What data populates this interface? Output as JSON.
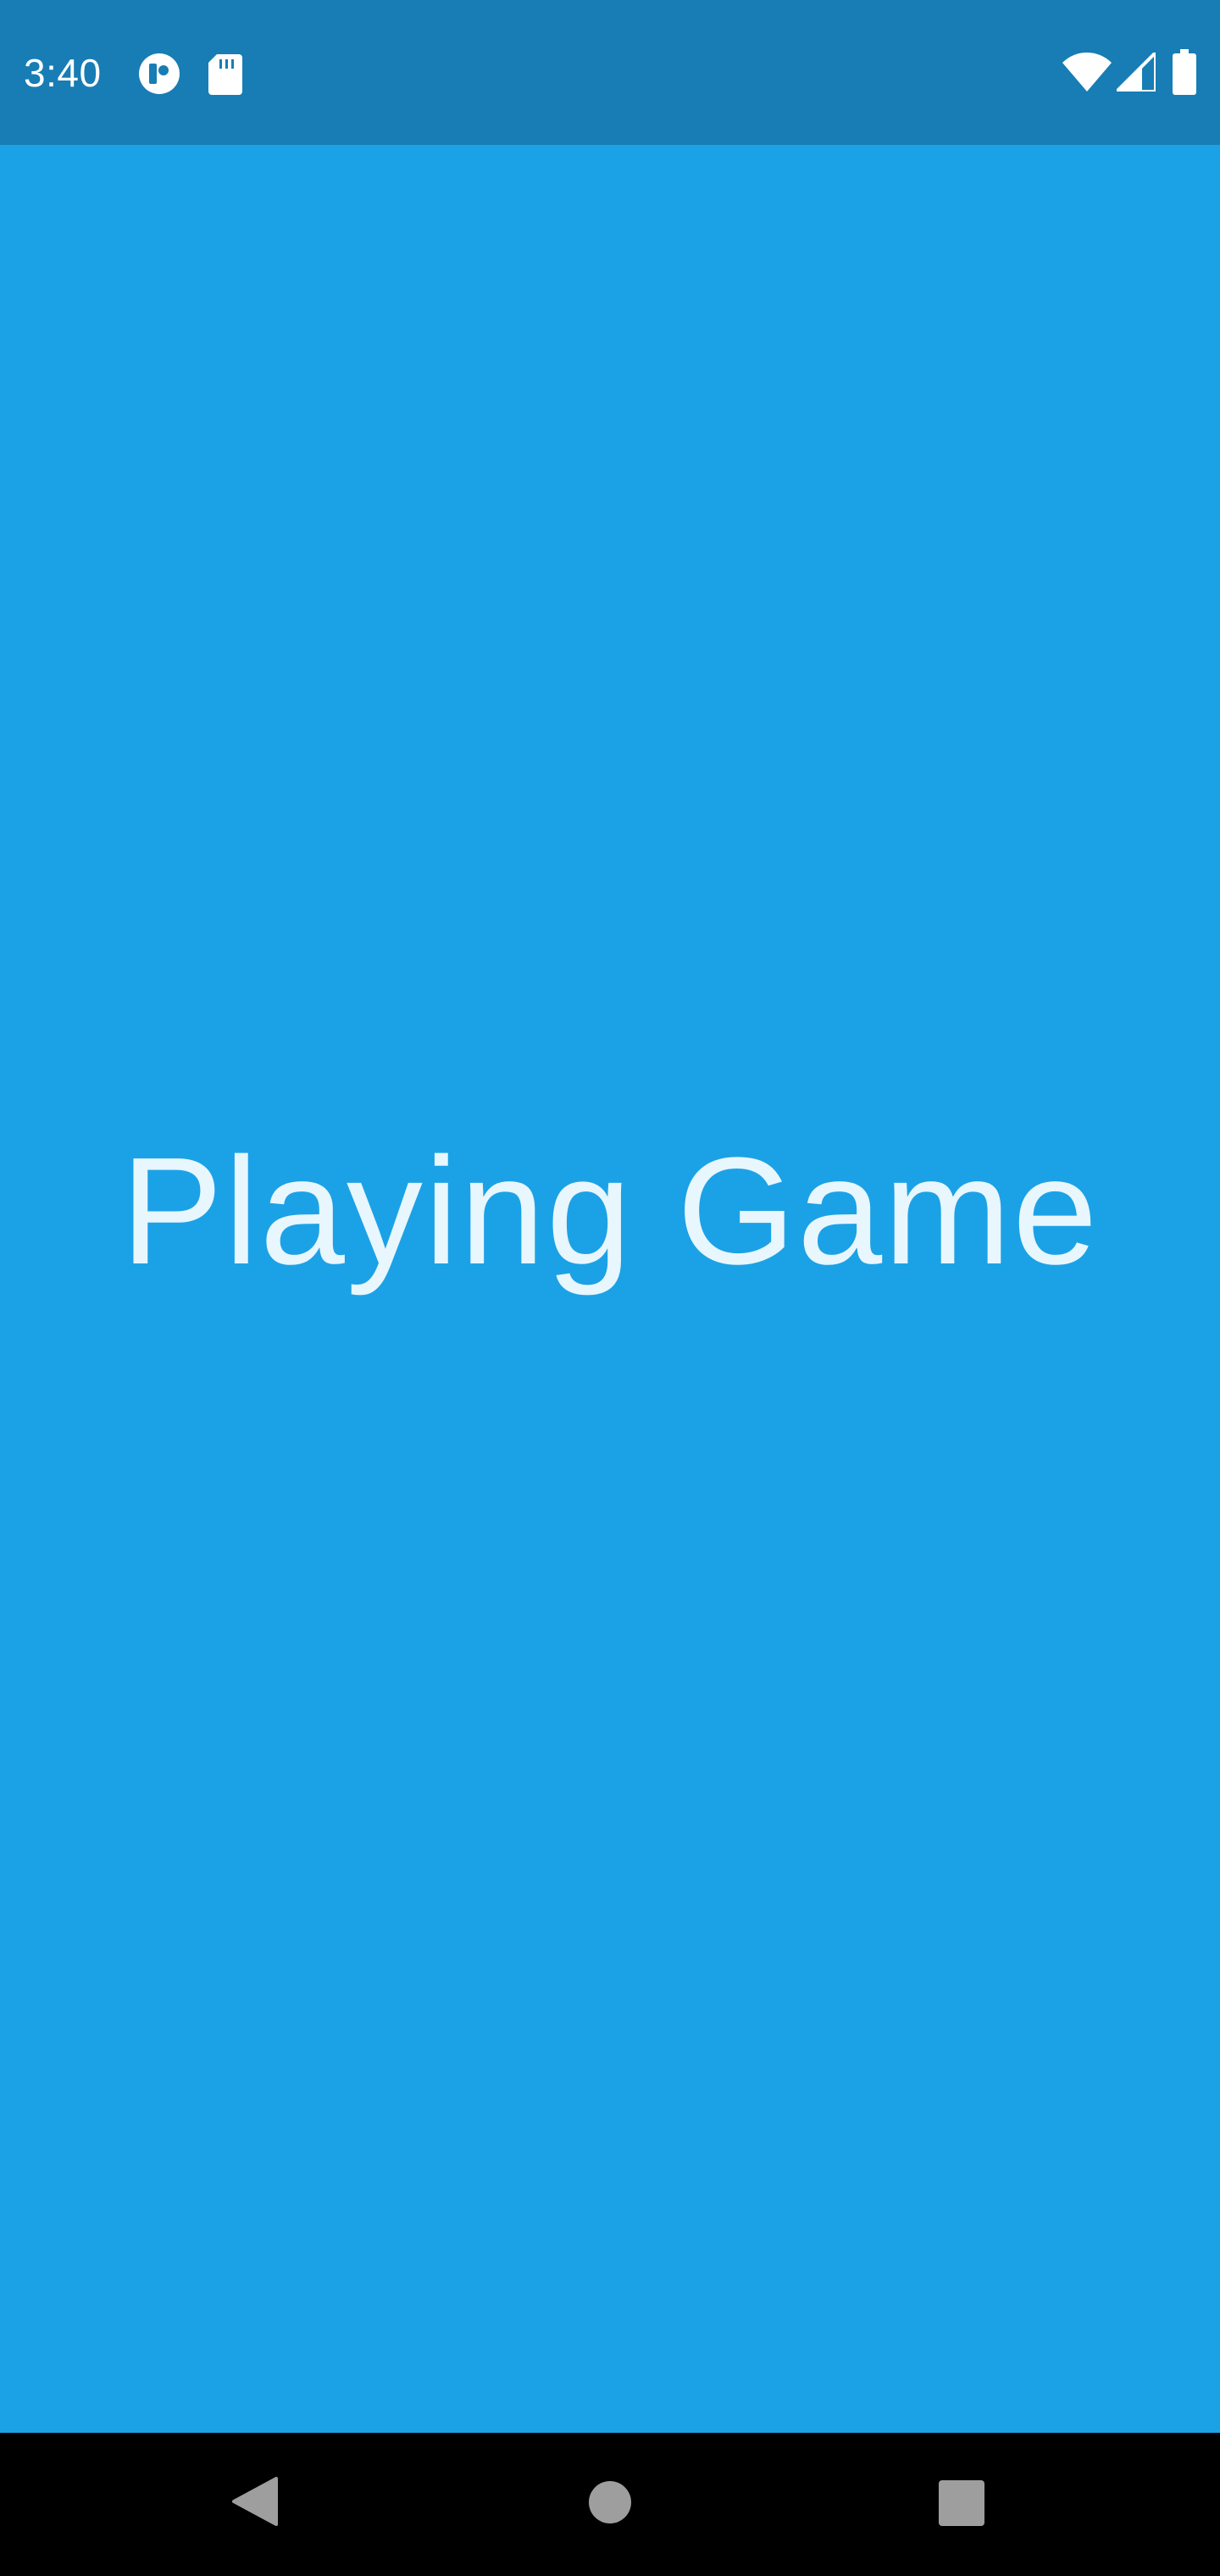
{
  "status_bar": {
    "time": "3:40",
    "left_icons": [
      "app-notification-icon",
      "sd-card-icon"
    ],
    "right_icons": [
      "wifi-icon",
      "cell-signal-icon",
      "battery-icon"
    ],
    "background_color": "#177db4"
  },
  "main": {
    "title": "Playing Game",
    "background_color": "#1ba2e6",
    "text_color": "#e8f6fd"
  },
  "nav_bar": {
    "buttons": [
      "back-button",
      "home-button",
      "recents-button"
    ],
    "icon_color": "#9e9e9e"
  }
}
